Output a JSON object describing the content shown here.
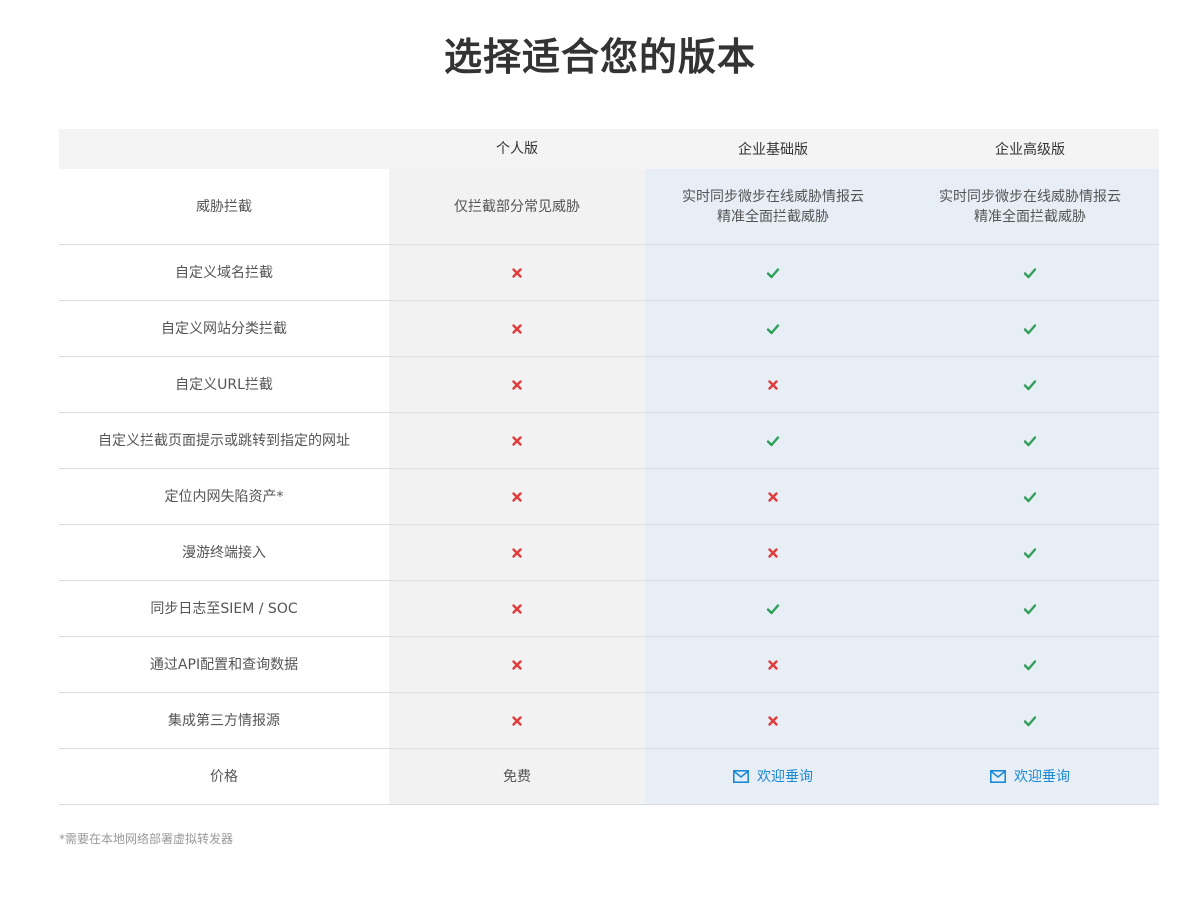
{
  "title": "选择适合您的版本",
  "columns": [
    "",
    "个人版",
    "企业基础版",
    "企业高级版"
  ],
  "threat_row": {
    "label": "威胁拦截",
    "personal": "仅拦截部分常见威胁",
    "basic": [
      "实时同步微步在线威胁情报云",
      "精准全面拦截威胁"
    ],
    "advanced": [
      "实时同步微步在线威胁情报云",
      "精准全面拦截威胁"
    ]
  },
  "features": [
    {
      "label": "自定义域名拦截",
      "personal": false,
      "basic": true,
      "advanced": true
    },
    {
      "label": "自定义网站分类拦截",
      "personal": false,
      "basic": true,
      "advanced": true
    },
    {
      "label": "自定义URL拦截",
      "personal": false,
      "basic": false,
      "advanced": true
    },
    {
      "label": "自定义拦截页面提示或跳转到指定的网址",
      "personal": false,
      "basic": true,
      "advanced": true
    },
    {
      "label": "定位内网失陷资产*",
      "personal": false,
      "basic": false,
      "advanced": true
    },
    {
      "label": "漫游终端接入",
      "personal": false,
      "basic": false,
      "advanced": true
    },
    {
      "label": "同步日志至SIEM / SOC",
      "personal": false,
      "basic": true,
      "advanced": true
    },
    {
      "label": "通过API配置和查询数据",
      "personal": false,
      "basic": false,
      "advanced": true
    },
    {
      "label": "集成第三方情报源",
      "personal": false,
      "basic": false,
      "advanced": true
    }
  ],
  "price_row": {
    "label": "价格",
    "personal": "免费",
    "basic": "欢迎垂询",
    "advanced": "欢迎垂询"
  },
  "footnote": "*需要在本地网络部署虚拟转发器",
  "colors": {
    "check": "#2e9e5b",
    "cross": "#e03a3a",
    "link": "#1b8ad6"
  }
}
